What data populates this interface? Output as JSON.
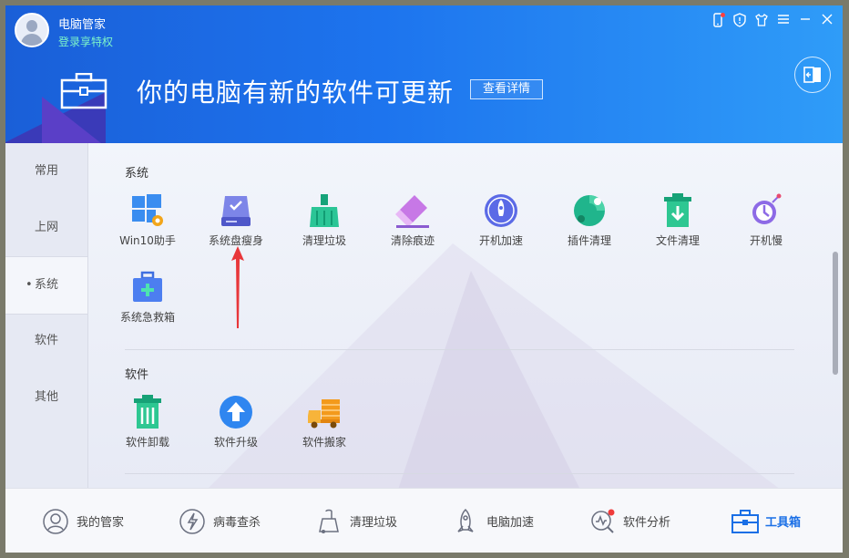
{
  "header": {
    "app_name": "电脑管家",
    "login_text": "登录享特权",
    "banner_text": "你的电脑有新的软件可更新",
    "detail_button": "查看详情"
  },
  "sidebar": {
    "items": [
      {
        "label": "常用"
      },
      {
        "label": "上网"
      },
      {
        "label": "系统"
      },
      {
        "label": "软件"
      },
      {
        "label": "其他"
      }
    ],
    "active": "系统"
  },
  "sections": {
    "system": {
      "title": "系统",
      "tools": [
        {
          "label": "Win10助手",
          "icon": "windows-gear-icon"
        },
        {
          "label": "系统盘瘦身",
          "icon": "disk-check-icon"
        },
        {
          "label": "清理垃圾",
          "icon": "broom-icon"
        },
        {
          "label": "清除痕迹",
          "icon": "eraser-icon"
        },
        {
          "label": "开机加速",
          "icon": "rocket-icon"
        },
        {
          "label": "插件清理",
          "icon": "puzzle-icon"
        },
        {
          "label": "文件清理",
          "icon": "trash-download-icon"
        },
        {
          "label": "开机慢",
          "icon": "power-slow-icon"
        },
        {
          "label": "系统急救箱",
          "icon": "firstaid-box-icon"
        }
      ]
    },
    "software": {
      "title": "软件",
      "tools": [
        {
          "label": "软件卸载",
          "icon": "trash-icon"
        },
        {
          "label": "软件升级",
          "icon": "upgrade-arrow-icon"
        },
        {
          "label": "软件搬家",
          "icon": "moving-truck-icon"
        }
      ]
    }
  },
  "bottom_nav": [
    {
      "label": "我的管家",
      "icon": "butler-icon"
    },
    {
      "label": "病毒查杀",
      "icon": "virus-scan-icon"
    },
    {
      "label": "清理垃圾",
      "icon": "vacuum-icon"
    },
    {
      "label": "电脑加速",
      "icon": "rocket-icon"
    },
    {
      "label": "软件分析",
      "icon": "analysis-icon"
    },
    {
      "label": "工具箱",
      "icon": "toolbox-icon"
    }
  ],
  "colors": {
    "header_start": "#1a5fd8",
    "header_end": "#2f9cf8",
    "accent": "#1a6fe6",
    "login_text": "#7ef5c9",
    "annotation_arrow": "#e8363a"
  }
}
